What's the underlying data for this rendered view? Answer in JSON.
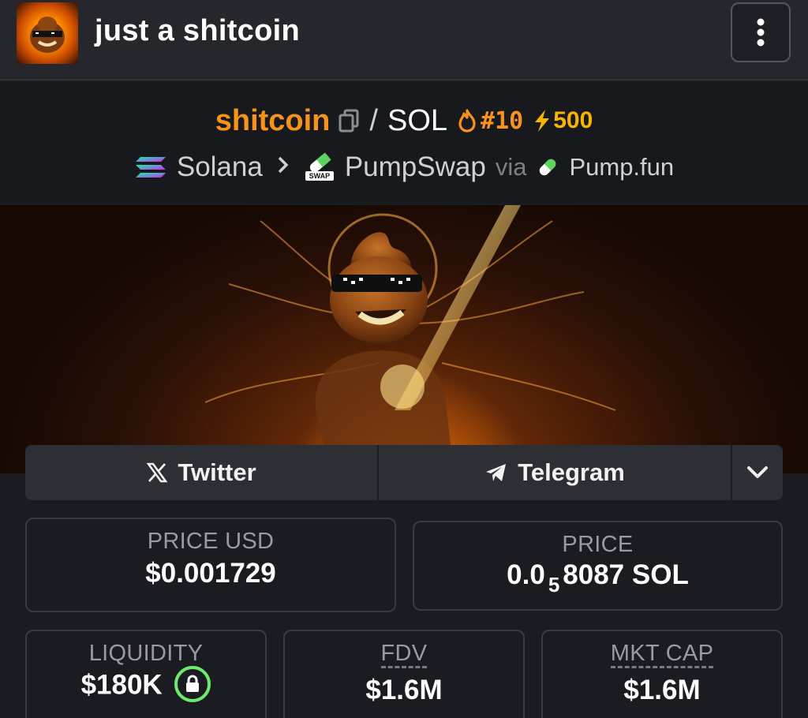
{
  "header": {
    "title": "just a shitcoin",
    "avatar_icon": "pixel-sunglasses-mascot-icon",
    "menu_icon": "vertical-dots-icon"
  },
  "pair": {
    "base_symbol": "shitcoin",
    "separator": "/",
    "quote_symbol": "SOL",
    "rank": "#10",
    "boost": "500",
    "colors": {
      "base": "#f7931a",
      "rank": "#f7931a",
      "boost": "#f7b500"
    }
  },
  "chain": {
    "network": "Solana",
    "dex": "PumpSwap",
    "dex_badge": "SWAP",
    "via_label": "via",
    "launchpad": "Pump.fun"
  },
  "socials": {
    "twitter_label": "Twitter",
    "telegram_label": "Telegram"
  },
  "stats": {
    "price_usd": {
      "label": "PRICE USD",
      "value": "$0.001729"
    },
    "price_native": {
      "label": "PRICE",
      "prefix": "0.0",
      "zeros_subscript": "5",
      "digits": "8087",
      "unit": "SOL"
    },
    "liquidity": {
      "label": "LIQUIDITY",
      "value": "$180K",
      "locked": true
    },
    "fdv": {
      "label": "FDV",
      "value": "$1.6M"
    },
    "mkt_cap": {
      "label": "MKT CAP",
      "value": "$1.6M"
    }
  },
  "colors": {
    "background": "#1b1c21",
    "header": "#26272d",
    "accent": "#f7931a",
    "lock": "#6ee86e"
  }
}
